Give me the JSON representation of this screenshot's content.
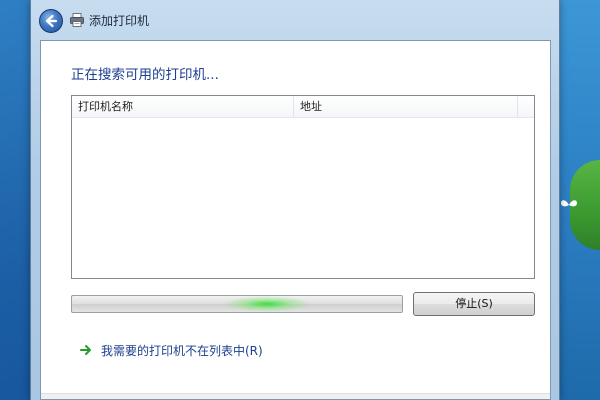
{
  "window": {
    "title": "添加打印机"
  },
  "content": {
    "heading": "正在搜索可用的打印机...",
    "list": {
      "columns": [
        "打印机名称",
        "地址"
      ],
      "rows": []
    },
    "progress": {
      "state": "indeterminate",
      "accent": "#38dc3c"
    },
    "stop_button": "停止(S)",
    "link": "我需要的打印机不在列表中(R)"
  },
  "icons": {
    "back": "back-arrow-icon",
    "title": "printer-icon",
    "link": "green-arrow-icon"
  }
}
